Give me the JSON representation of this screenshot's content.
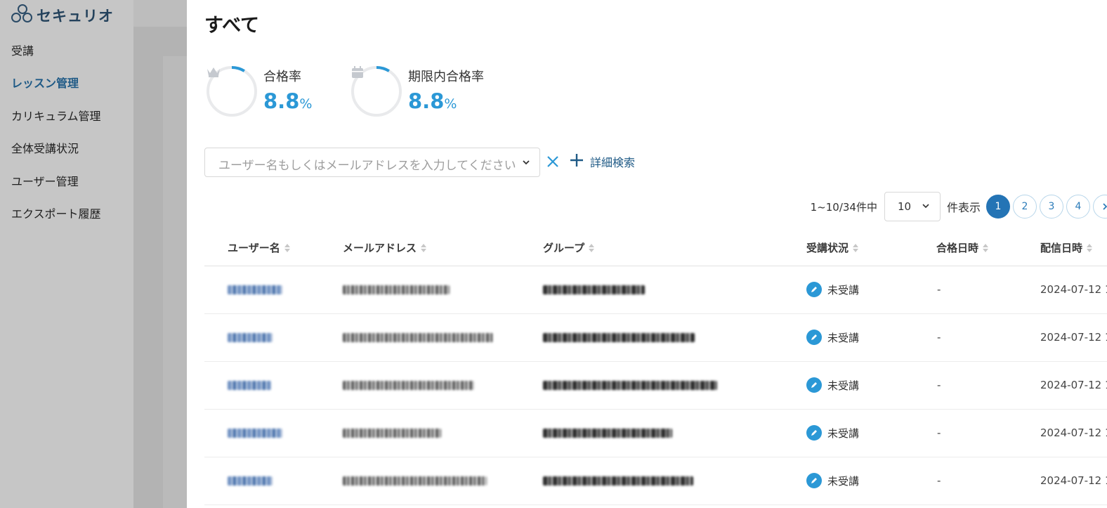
{
  "app": {
    "logo_text": "セキュリオ"
  },
  "sidebar": {
    "items": [
      {
        "label": "受講"
      },
      {
        "label": "レッスン管理"
      },
      {
        "label": "カリキュラム管理"
      },
      {
        "label": "全体受講状況"
      },
      {
        "label": "ユーザー管理"
      },
      {
        "label": "エクスポート履歴"
      }
    ],
    "active_index": 1
  },
  "panel": {
    "title": "すべて",
    "stats": [
      {
        "label": "合格率",
        "value": "8.8",
        "unit": "%",
        "icon": "crown-icon",
        "ratio": 0.088
      },
      {
        "label": "期限内合格率",
        "value": "8.8",
        "unit": "%",
        "icon": "calendar-icon",
        "ratio": 0.088
      }
    ],
    "search": {
      "placeholder": "ユーザー名もしくはメールアドレスを入力してください",
      "advanced_label": "詳細検索"
    },
    "pagination": {
      "count_text": "1~10/34件中",
      "page_size": "10",
      "per_page_label": "件表示",
      "pages": [
        "1",
        "2",
        "3",
        "4"
      ],
      "current_page": "1"
    },
    "table": {
      "columns": [
        "ユーザー名",
        "メールアドレス",
        "グループ",
        "受講状況",
        "合格日時",
        "配信日時"
      ],
      "rows": [
        {
          "status": "未受講",
          "passed_at": "-",
          "delivered_at": "2024-07-12 1"
        },
        {
          "status": "未受講",
          "passed_at": "-",
          "delivered_at": "2024-07-12 1"
        },
        {
          "status": "未受講",
          "passed_at": "-",
          "delivered_at": "2024-07-12 1"
        },
        {
          "status": "未受講",
          "passed_at": "-",
          "delivered_at": "2024-07-12 1"
        },
        {
          "status": "未受講",
          "passed_at": "-",
          "delivered_at": "2024-07-12 1"
        }
      ]
    }
  },
  "colors": {
    "accent": "#2b98d6",
    "brand": "#1f5a86",
    "page_active": "#2474b5"
  }
}
